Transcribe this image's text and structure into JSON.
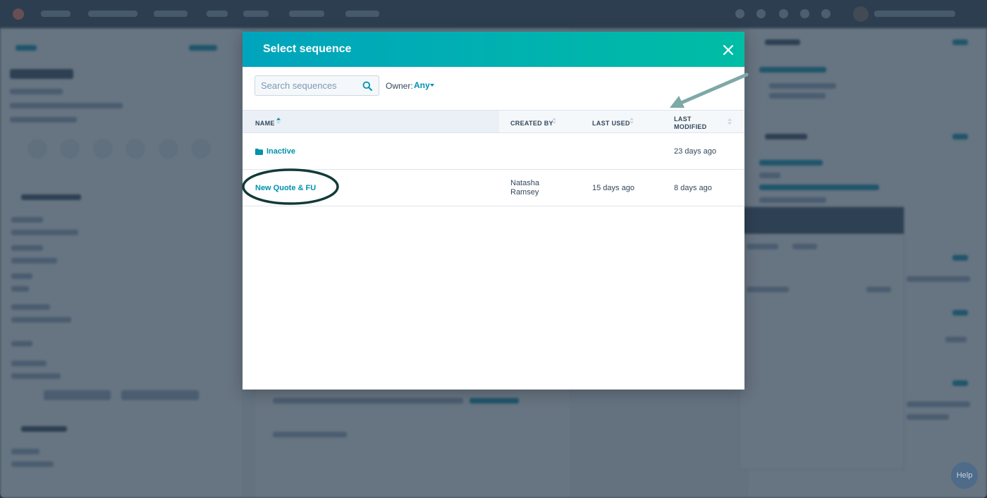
{
  "modal": {
    "title": "Select sequence",
    "search_placeholder": "Search sequences",
    "owner_label": "Owner:",
    "owner_value": "Any"
  },
  "table": {
    "headers": {
      "name": "NAME",
      "created_by": "CREATED BY",
      "last_used": "LAST USED",
      "last_modified_line1": "LAST",
      "last_modified_line2": "MODIFIED"
    },
    "rows": [
      {
        "name": "Inactive",
        "type": "folder",
        "created_by_line1": "",
        "created_by_line2": "",
        "last_used": "",
        "last_modified": "23 days ago"
      },
      {
        "name": "New Quote & FU",
        "type": "sequence",
        "created_by_line1": "Natasha",
        "created_by_line2": "Ramsey",
        "last_used": "15 days ago",
        "last_modified": "8 days ago"
      }
    ]
  },
  "help_button": {
    "label": "Help"
  },
  "colors": {
    "accent": "#0091ae",
    "header_start": "#00a4bd",
    "header_end": "#00bda5",
    "annotation": "#7fa8a8",
    "highlight_ring": "#123a38"
  },
  "icons": [
    "close-icon",
    "search-icon",
    "sort-icon",
    "folder-icon",
    "arrow-annotation",
    "ellipse-annotation"
  ]
}
